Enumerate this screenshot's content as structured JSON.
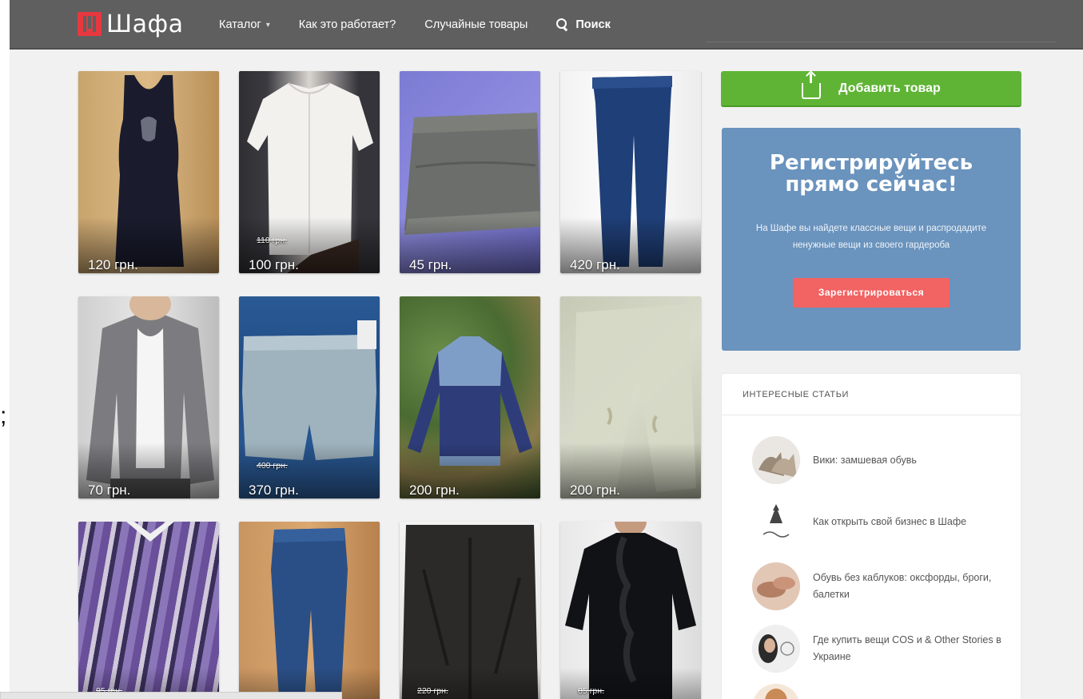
{
  "brand": {
    "name": "Шафа",
    "logo_color": "#e8383f"
  },
  "nav": {
    "items": [
      {
        "label": "Каталог",
        "has_caret": true,
        "caret": "▾"
      },
      {
        "label": "Как это работает?"
      },
      {
        "label": "Случайные товары"
      }
    ],
    "search_label": "Поиск"
  },
  "products": [
    {
      "price": "120 грн.",
      "old_price": ""
    },
    {
      "price": "100 грн.",
      "old_price": "110 грн."
    },
    {
      "price": "45 грн.",
      "old_price": ""
    },
    {
      "price": "420 грн.",
      "old_price": ""
    },
    {
      "price": "70 грн.",
      "old_price": ""
    },
    {
      "price": "370 грн.",
      "old_price": "400 грн."
    },
    {
      "price": "200 грн.",
      "old_price": ""
    },
    {
      "price": "200 грн.",
      "old_price": ""
    },
    {
      "price": "",
      "old_price": "95 грн."
    },
    {
      "price": "",
      "old_price": ""
    },
    {
      "price": "",
      "old_price": "220 грн."
    },
    {
      "price": "",
      "old_price": "85 грн."
    }
  ],
  "sidebar": {
    "add_button": "Добавить товар",
    "register": {
      "title": "Регистрируйтесь прямо сейчас!",
      "text": "На Шафе вы найдете классные вещи и распродадите ненужные вещи из своего гардероба",
      "button": "Зарегистрироваться"
    },
    "articles": {
      "heading": "ИНТЕРЕСНЫЕ СТАТЬИ",
      "items": [
        {
          "title": "Вики: замшевая обувь"
        },
        {
          "title": "Как открыть свой бизнес в Шафе"
        },
        {
          "title": "Обувь без каблуков: оксфорды, броги, балетки"
        },
        {
          "title": "Где купить вещи COS и & Other Stories в Украине"
        },
        {
          "title": ""
        }
      ]
    }
  },
  "colors": {
    "navbar": "#5f5f5f",
    "add_button": "#5fb435",
    "register_bg": "#6a93bd",
    "register_button": "#f26363"
  },
  "edge_mark": ";"
}
